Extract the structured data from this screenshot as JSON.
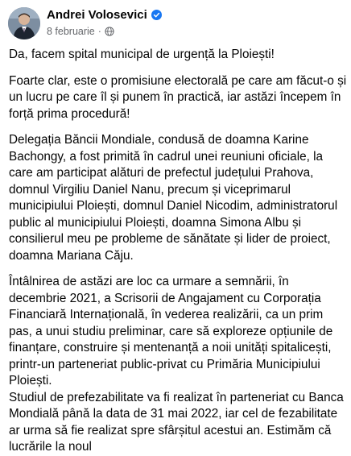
{
  "post": {
    "author": "Andrei Volosevici",
    "date": "8 februarie",
    "separator": "·",
    "author_verified": true,
    "privacy_icon": "globe-icon",
    "paragraphs": [
      "Da, facem spital municipal de urgență la Ploiești!",
      "Foarte clar, este o promisiune electorală pe care am făcut-o și un lucru pe care îl și punem în practică, iar astăzi începem în forță prima procedură!",
      "Delegația Băncii Mondiale, condusă de doamna Karine Bachongy, a fost primită în cadrul unei reuniuni oficiale, la care am participat alături de prefectul județului Prahova, domnul Virgiliu Daniel Nanu, precum și viceprimarul municipiului Ploiești, domnul Daniel Nicodim, administratorul public al municipiului Ploiești, doamna Simona Albu și consilierul meu pe probleme de sănătate și lider de proiect, doamna Mariana Căju.",
      "Întâlnirea de astăzi are loc ca urmare a semnării, în decembrie 2021, a Scrisorii de Angajament cu Corporația Financiară Internațională, în vederea realizării, ca un prim pas, a unui studiu preliminar, care să exploreze opțiunile de finanțare, construire și mentenanță a noii unități spitalicești, printr-un parteneriat public-privat cu Primăria Municipiului Ploiești.",
      "Studiul de prefezabilitate va fi realizat în parteneriat cu Banca Mondială până la data de 31 mai 2022, iar cel de fezabilitate ar urma să fie realizat spre sfârșitul acestui an. Estimăm că lucrările la noul"
    ]
  },
  "colors": {
    "text": "#050505",
    "secondary": "#65676b",
    "verified_badge": "#1877f2"
  }
}
